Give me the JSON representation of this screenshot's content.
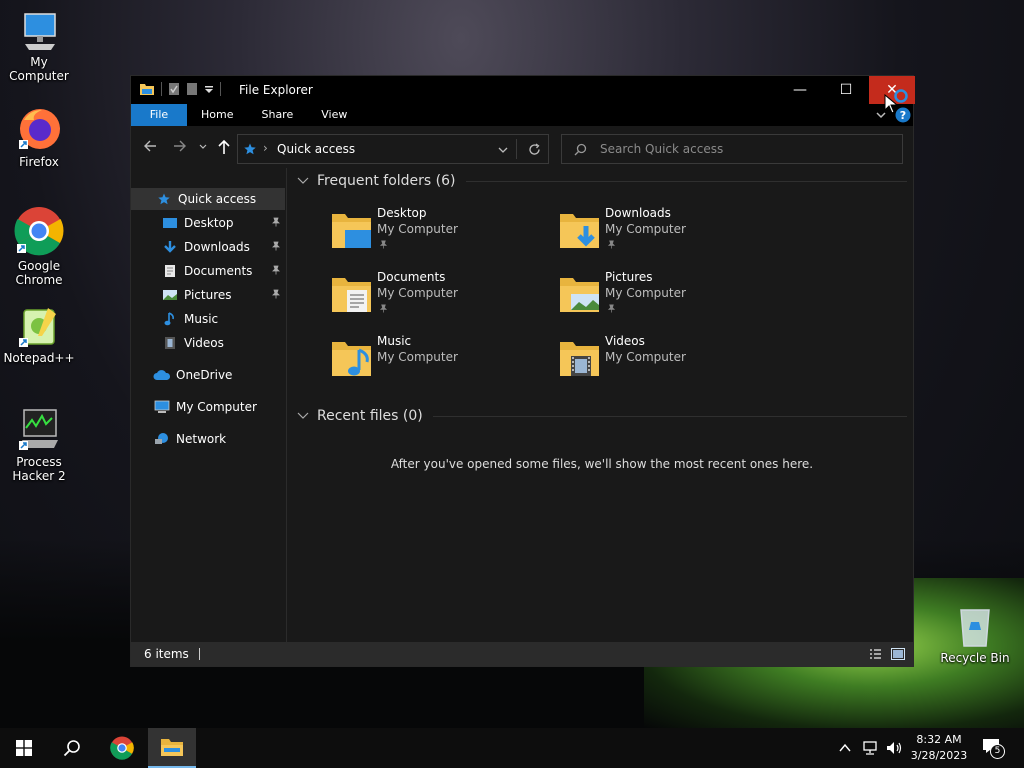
{
  "desktop": {
    "icons": [
      {
        "label": "My Computer"
      },
      {
        "label": "Firefox"
      },
      {
        "label": "Google Chrome"
      },
      {
        "label": "Notepad++"
      },
      {
        "label": "Process Hacker 2"
      },
      {
        "label": "Recycle Bin"
      }
    ]
  },
  "window": {
    "title": "File Explorer",
    "controls": {
      "minimize": "—",
      "maximize": "☐",
      "close": "✕"
    },
    "ribbon": {
      "tabs": [
        "File",
        "Home",
        "Share",
        "View"
      ]
    },
    "address": {
      "path": "Quick access"
    },
    "search": {
      "placeholder": "Search Quick access"
    },
    "nav": {
      "items": [
        {
          "label": "Quick access"
        },
        {
          "label": "Desktop"
        },
        {
          "label": "Downloads"
        },
        {
          "label": "Documents"
        },
        {
          "label": "Pictures"
        },
        {
          "label": "Music"
        },
        {
          "label": "Videos"
        },
        {
          "label": "OneDrive"
        },
        {
          "label": "My Computer"
        },
        {
          "label": "Network"
        }
      ]
    },
    "frequent": {
      "header": "Frequent folders (6)",
      "folders": [
        {
          "name": "Desktop",
          "location": "My Computer"
        },
        {
          "name": "Downloads",
          "location": "My Computer"
        },
        {
          "name": "Documents",
          "location": "My Computer"
        },
        {
          "name": "Pictures",
          "location": "My Computer"
        },
        {
          "name": "Music",
          "location": "My Computer"
        },
        {
          "name": "Videos",
          "location": "My Computer"
        }
      ]
    },
    "recent": {
      "header": "Recent files (0)",
      "empty_message": "After you've opened some files, we'll show the most recent ones here."
    },
    "status": {
      "items": "6 items"
    }
  },
  "taskbar": {
    "time": "8:32 AM",
    "date": "3/28/2023",
    "notifications": "5"
  },
  "colors": {
    "accent": "#1979ca",
    "close_hover": "#c42b1c",
    "folder": "#f5c658"
  }
}
